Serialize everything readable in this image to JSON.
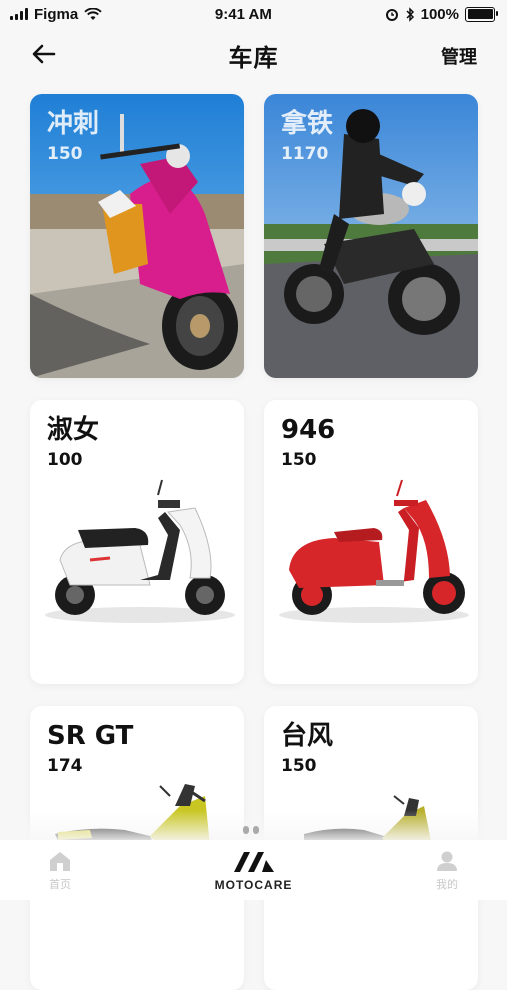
{
  "status_bar": {
    "carrier": "Figma",
    "time": "9:41 AM",
    "battery": "100%"
  },
  "header": {
    "title": "车库",
    "manage_label": "管理"
  },
  "bikes": [
    {
      "name": "冲刺",
      "cc": "150"
    },
    {
      "name": "拿铁",
      "cc": "1170"
    },
    {
      "name": "淑女",
      "cc": "100"
    },
    {
      "name": "946",
      "cc": "150"
    },
    {
      "name": "SR GT",
      "cc": "174"
    },
    {
      "name": "台风",
      "cc": "150"
    }
  ],
  "tab_bar": {
    "home": "首页",
    "brand": "MOTOCARE",
    "mine": "我的"
  },
  "colors": {
    "accent": "#111111",
    "inactive": "#c8c8c8",
    "vespa_pink": "#d81e8c",
    "vespa_red": "#d6262a",
    "sky_blue": "#2e8de0"
  }
}
